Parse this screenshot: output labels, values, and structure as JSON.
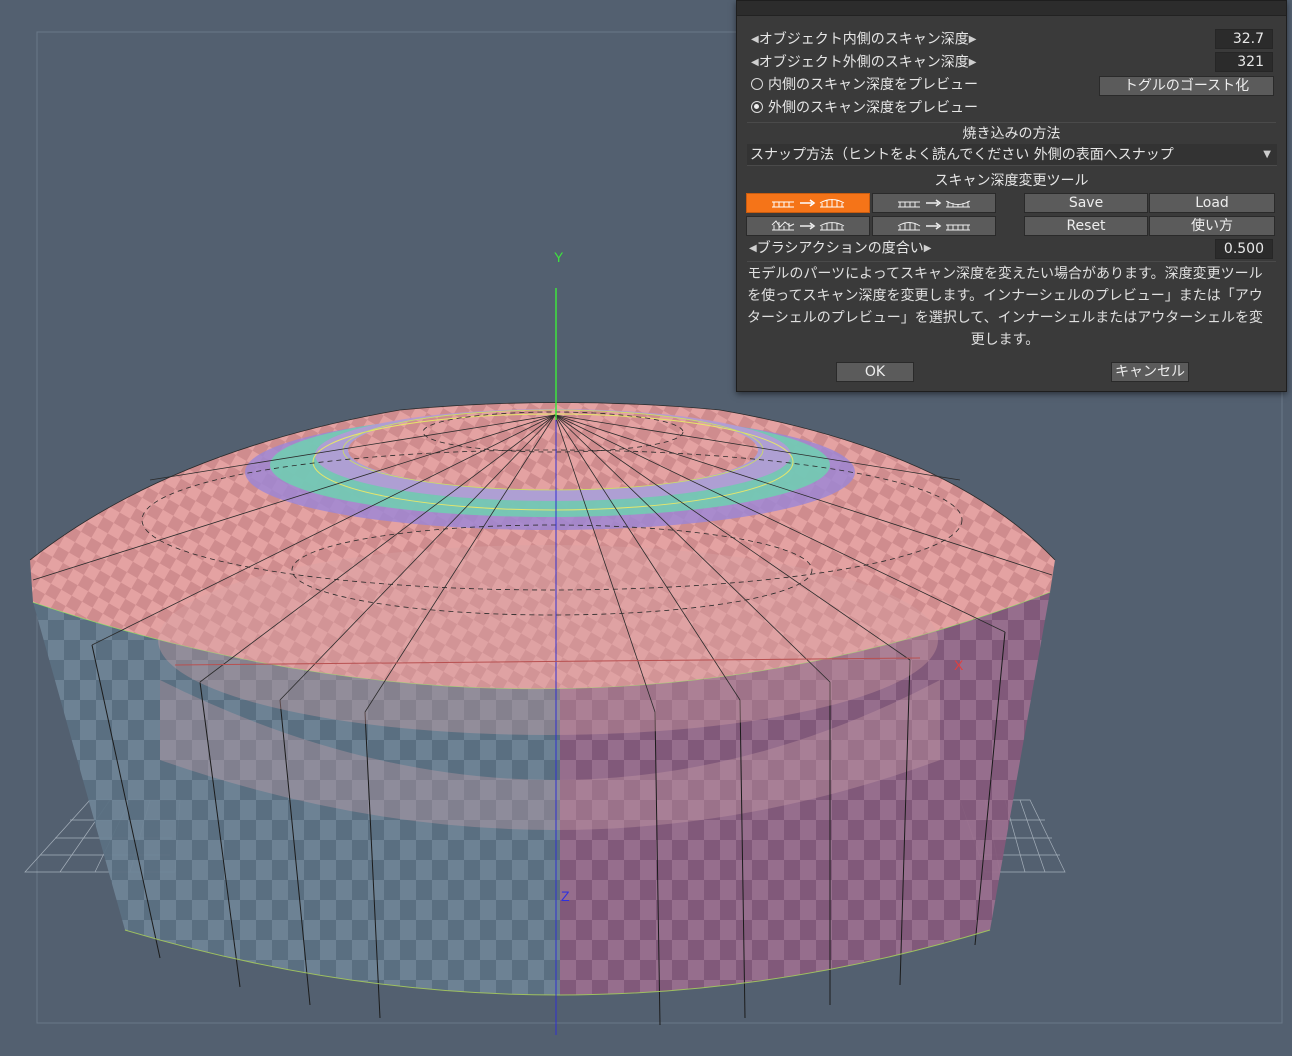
{
  "viewport": {
    "axis_labels": {
      "y": "Y",
      "x": "X",
      "z": "Z"
    }
  },
  "panel": {
    "inner_depth_label": "オブジェクト内側のスキャン深度",
    "inner_depth_value": "32.7",
    "outer_depth_label": "オブジェクト外側のスキャン深度",
    "outer_depth_value": "321",
    "preview_inner_label": "内側のスキャン深度をプレビュー",
    "preview_outer_label": "外側のスキャン深度をプレビュー",
    "ghost_toggle_label": "トグルのゴースト化",
    "bake_method_title": "焼き込みの方法",
    "snap_method_label": "スナップ方法（ヒントをよく読んでください 外側の表面へスナップ",
    "scan_tool_title": "スキャン深度変更ツール",
    "save_label": "Save",
    "load_label": "Load",
    "reset_label": "Reset",
    "usage_label": "使い方",
    "brush_action_label": "ブラシアクションの度合い",
    "brush_action_value": "0.500",
    "hint_text": "モデルのパーツによってスキャン深度を変えたい場合があります。深度変更ツールを使ってスキャン深度を変更します。インナーシェルのプレビュー」または「アウターシェルのプレビュー」を選択して、インナーシェルまたはアウターシェルを変更します。",
    "ok_label": "OK",
    "cancel_label": "キャンセル"
  }
}
